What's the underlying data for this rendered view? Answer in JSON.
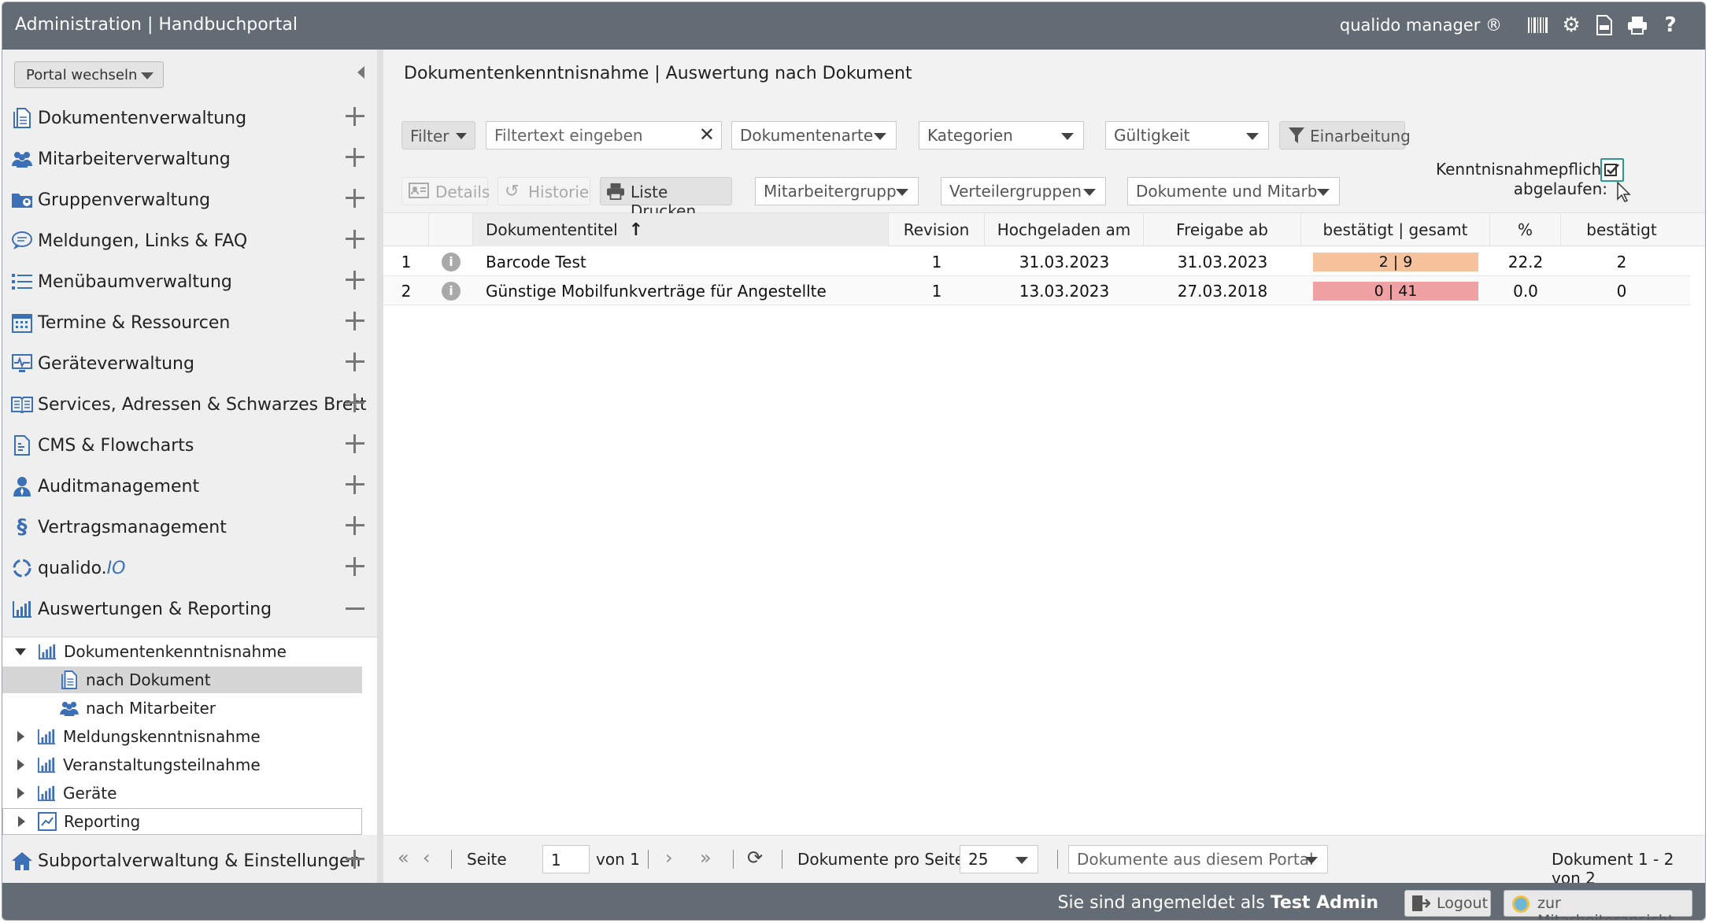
{
  "header": {
    "title": "Administration | Handbuchportal",
    "brand": "qualido manager ®",
    "icons": [
      "barcode-icon",
      "settings-icon",
      "export-icon",
      "print-icon",
      "help-icon"
    ]
  },
  "sidebar": {
    "portal_button": "Portal wechseln",
    "items": [
      {
        "label": "Dokumentenverwaltung",
        "icon": "document-icon"
      },
      {
        "label": "Mitarbeiterverwaltung",
        "icon": "users-icon"
      },
      {
        "label": "Gruppenverwaltung",
        "icon": "group-folder-icon"
      },
      {
        "label": "Meldungen, Links & FAQ",
        "icon": "chat-icon"
      },
      {
        "label": "Menübaumverwaltung",
        "icon": "list-icon"
      },
      {
        "label": "Termine & Ressourcen",
        "icon": "calendar-icon"
      },
      {
        "label": "Geräteverwaltung",
        "icon": "device-icon"
      },
      {
        "label": "Services, Adressen & Schwarzes Brett",
        "icon": "book-icon"
      },
      {
        "label": "CMS & Flowcharts",
        "icon": "cms-icon"
      },
      {
        "label": "Auditmanagement",
        "icon": "auditor-icon"
      },
      {
        "label": "Vertragsmanagement",
        "icon": "paragraph-icon"
      },
      {
        "label": "qualido.",
        "label_italic": "IO",
        "icon": "qualido-io-icon"
      },
      {
        "label": "Auswertungen & Reporting",
        "icon": "bar-chart-icon"
      }
    ],
    "tree": {
      "dokumentenkenntnisnahme": "Dokumentenkenntnisnahme",
      "nach_dokument": "nach Dokument",
      "nach_mitarbeiter": "nach Mitarbeiter",
      "meldungskenntnisnahme": "Meldungskenntnisnahme",
      "veranstaltungsteilnahme": "Veranstaltungsteilnahme",
      "geraete": "Geräte",
      "reporting": "Reporting"
    },
    "subportal": "Subportalverwaltung & Einstellungen"
  },
  "main": {
    "breadcrumb": "Dokumentenkenntnisnahme | Auswertung nach Dokument",
    "filter": {
      "filter_button": "Filter",
      "search_placeholder": "Filtertext eingeben",
      "dokumentenarte": "Dokumentenarte",
      "kategorien": "Kategorien",
      "gueltigkeit": "Gültigkeit",
      "einarbeitung": "Einarbeitung"
    },
    "toolbar": {
      "details": "Details",
      "historie": "Historie",
      "liste_drucken": "Liste Drucken",
      "mitarbeitergruppen": "Mitarbeitergrupp",
      "verteilergruppen": "Verteilergruppen",
      "dokumente_und_mitarb": "Dokumente und Mitarb",
      "kenntnisnahme_line1": "Kenntnisnahmepflicht",
      "kenntnisnahme_line2": "abgelaufen:"
    },
    "table": {
      "columns": {
        "title": "Dokumententitel",
        "revision": "Revision",
        "uploaded": "Hochgeladen am",
        "release": "Freigabe ab",
        "confirmed_total": "bestätigt | gesamt",
        "percent": "%",
        "confirmed": "bestätigt"
      },
      "rows": [
        {
          "num": "1",
          "title": "Barcode Test",
          "revision": "1",
          "uploaded": "31.03.2023",
          "release": "31.03.2023",
          "ratio": "2 | 9",
          "percent": "22.2",
          "confirmed": "2",
          "bar_color": "#f5c29b"
        },
        {
          "num": "2",
          "title": "Günstige Mobilfunkverträge für Angestellte",
          "revision": "1",
          "uploaded": "13.03.2023",
          "release": "27.03.2018",
          "ratio": "0 | 41",
          "percent": "0.0",
          "confirmed": "0",
          "bar_color": "#f0a1a3"
        }
      ]
    },
    "pager": {
      "seite": "Seite",
      "page_value": "1",
      "von": "von 1",
      "per_page_label": "Dokumente pro Seite:",
      "per_page_value": "25",
      "scope": "Dokumente aus diesem Portal",
      "summary": "Dokument 1 - 2 von 2"
    }
  },
  "footer": {
    "logged_in_prefix": "Sie sind angemeldet als",
    "user": "Test Admin",
    "logout": "Logout",
    "employee_view": "zur Mitarbeiteransicht"
  }
}
